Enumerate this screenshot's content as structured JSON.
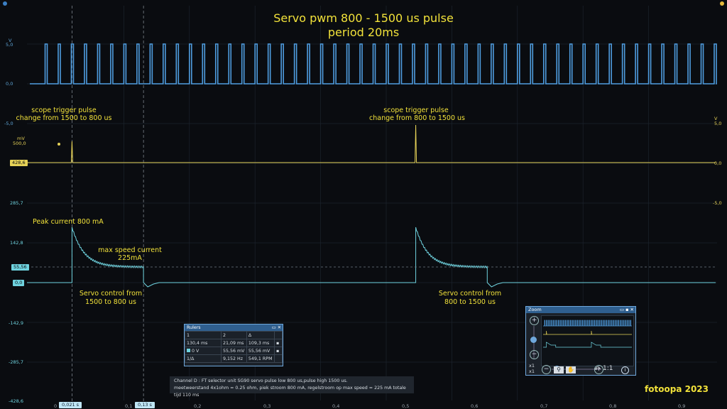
{
  "title": {
    "line1": "Servo pwm 800 - 1500 us pulse",
    "line2": "period 20ms"
  },
  "annotations": {
    "trigger_left_1": "scope trigger pulse",
    "trigger_left_2": "change from 1500 to 800 us",
    "trigger_right_1": "scope trigger pulse",
    "trigger_right_2": "change from 800 to 1500 us",
    "peak": "Peak current 800 mA",
    "maxspeed_1": "max speed current",
    "maxspeed_2": "225mA",
    "servo_left_1": "Servo control from",
    "servo_left_2": "1500 to 800 us",
    "servo_right_1": "Servo control from",
    "servo_right_2": "800 to 1500 us"
  },
  "channels": {
    "a": {
      "unit": "V",
      "top": "5,0",
      "zero": "0,0",
      "bottom": "-5,0",
      "color": "#4f9de0"
    },
    "b": {
      "unit": "mV",
      "top": "500,0",
      "value": "428,6",
      "color": "#e6d257"
    },
    "b_right": {
      "unit": "V",
      "top": "5,0",
      "zero": "0,0",
      "bottom": "-5,0"
    },
    "d": {
      "ticks": [
        "285,7",
        "142,8",
        "0,0",
        "-142,9",
        "-285,7",
        "-428,6"
      ],
      "marker": "55,56",
      "color": "#6fd3df"
    }
  },
  "time_axis": {
    "ticks": [
      "0,1",
      "0,2",
      "0,3",
      "0,4",
      "0,5",
      "0,6",
      "0,7",
      "0,8",
      "0,9"
    ],
    "first": "0",
    "cursor1": "0,021 s",
    "cursor2": "0,13 s"
  },
  "rulers": {
    "title": "Rulers",
    "headers": [
      "1",
      "2",
      "Δ"
    ],
    "row_time": [
      "130,4 ms",
      "21,09 ms",
      "109,3 ms"
    ],
    "row_volt": [
      "0 V",
      "55,56 mV",
      "55,56 mV"
    ],
    "row_freq": [
      "1/Δ",
      "9,152 Hz",
      "549,1 RPM"
    ]
  },
  "zoom": {
    "title": "Zoom",
    "plus": "+",
    "minus": "−",
    "ratio": "1:1",
    "x1a": "x1",
    "x1b": "x1"
  },
  "info": {
    "line1": "Channel D : FT selector unit SG90 servo pulse low 800 us,pulse high 1500 us.",
    "line2": "meetweerstand 4x1ohm = 0.25 ohm, piek stroom 800 mA, regelstroom op max speed = 225 mA totale tijd 110 ms"
  },
  "signature": "fotoopa 2023",
  "chart_data": {
    "type": "line",
    "title": "Servo pwm 800 - 1500 us pulse period 20ms",
    "xlabel": "",
    "ylabel": "",
    "x_range": [
      0,
      1.0
    ],
    "series": [
      {
        "name": "A",
        "unit": "V",
        "period_s": 0.02,
        "low": 0,
        "high": 5
      },
      {
        "name": "B",
        "unit": "mV",
        "trigger_times_s": [
          0.021,
          0.545
        ],
        "baseline": 428.6
      },
      {
        "name": "D",
        "unit": "mA",
        "events": [
          {
            "t_start": 0.021,
            "peak": 800,
            "plateau": 225,
            "t_end": 0.13
          },
          {
            "t_start": 0.545,
            "peak": 800,
            "plateau": 225,
            "t_end": 0.654
          }
        ]
      }
    ],
    "grid": true
  }
}
